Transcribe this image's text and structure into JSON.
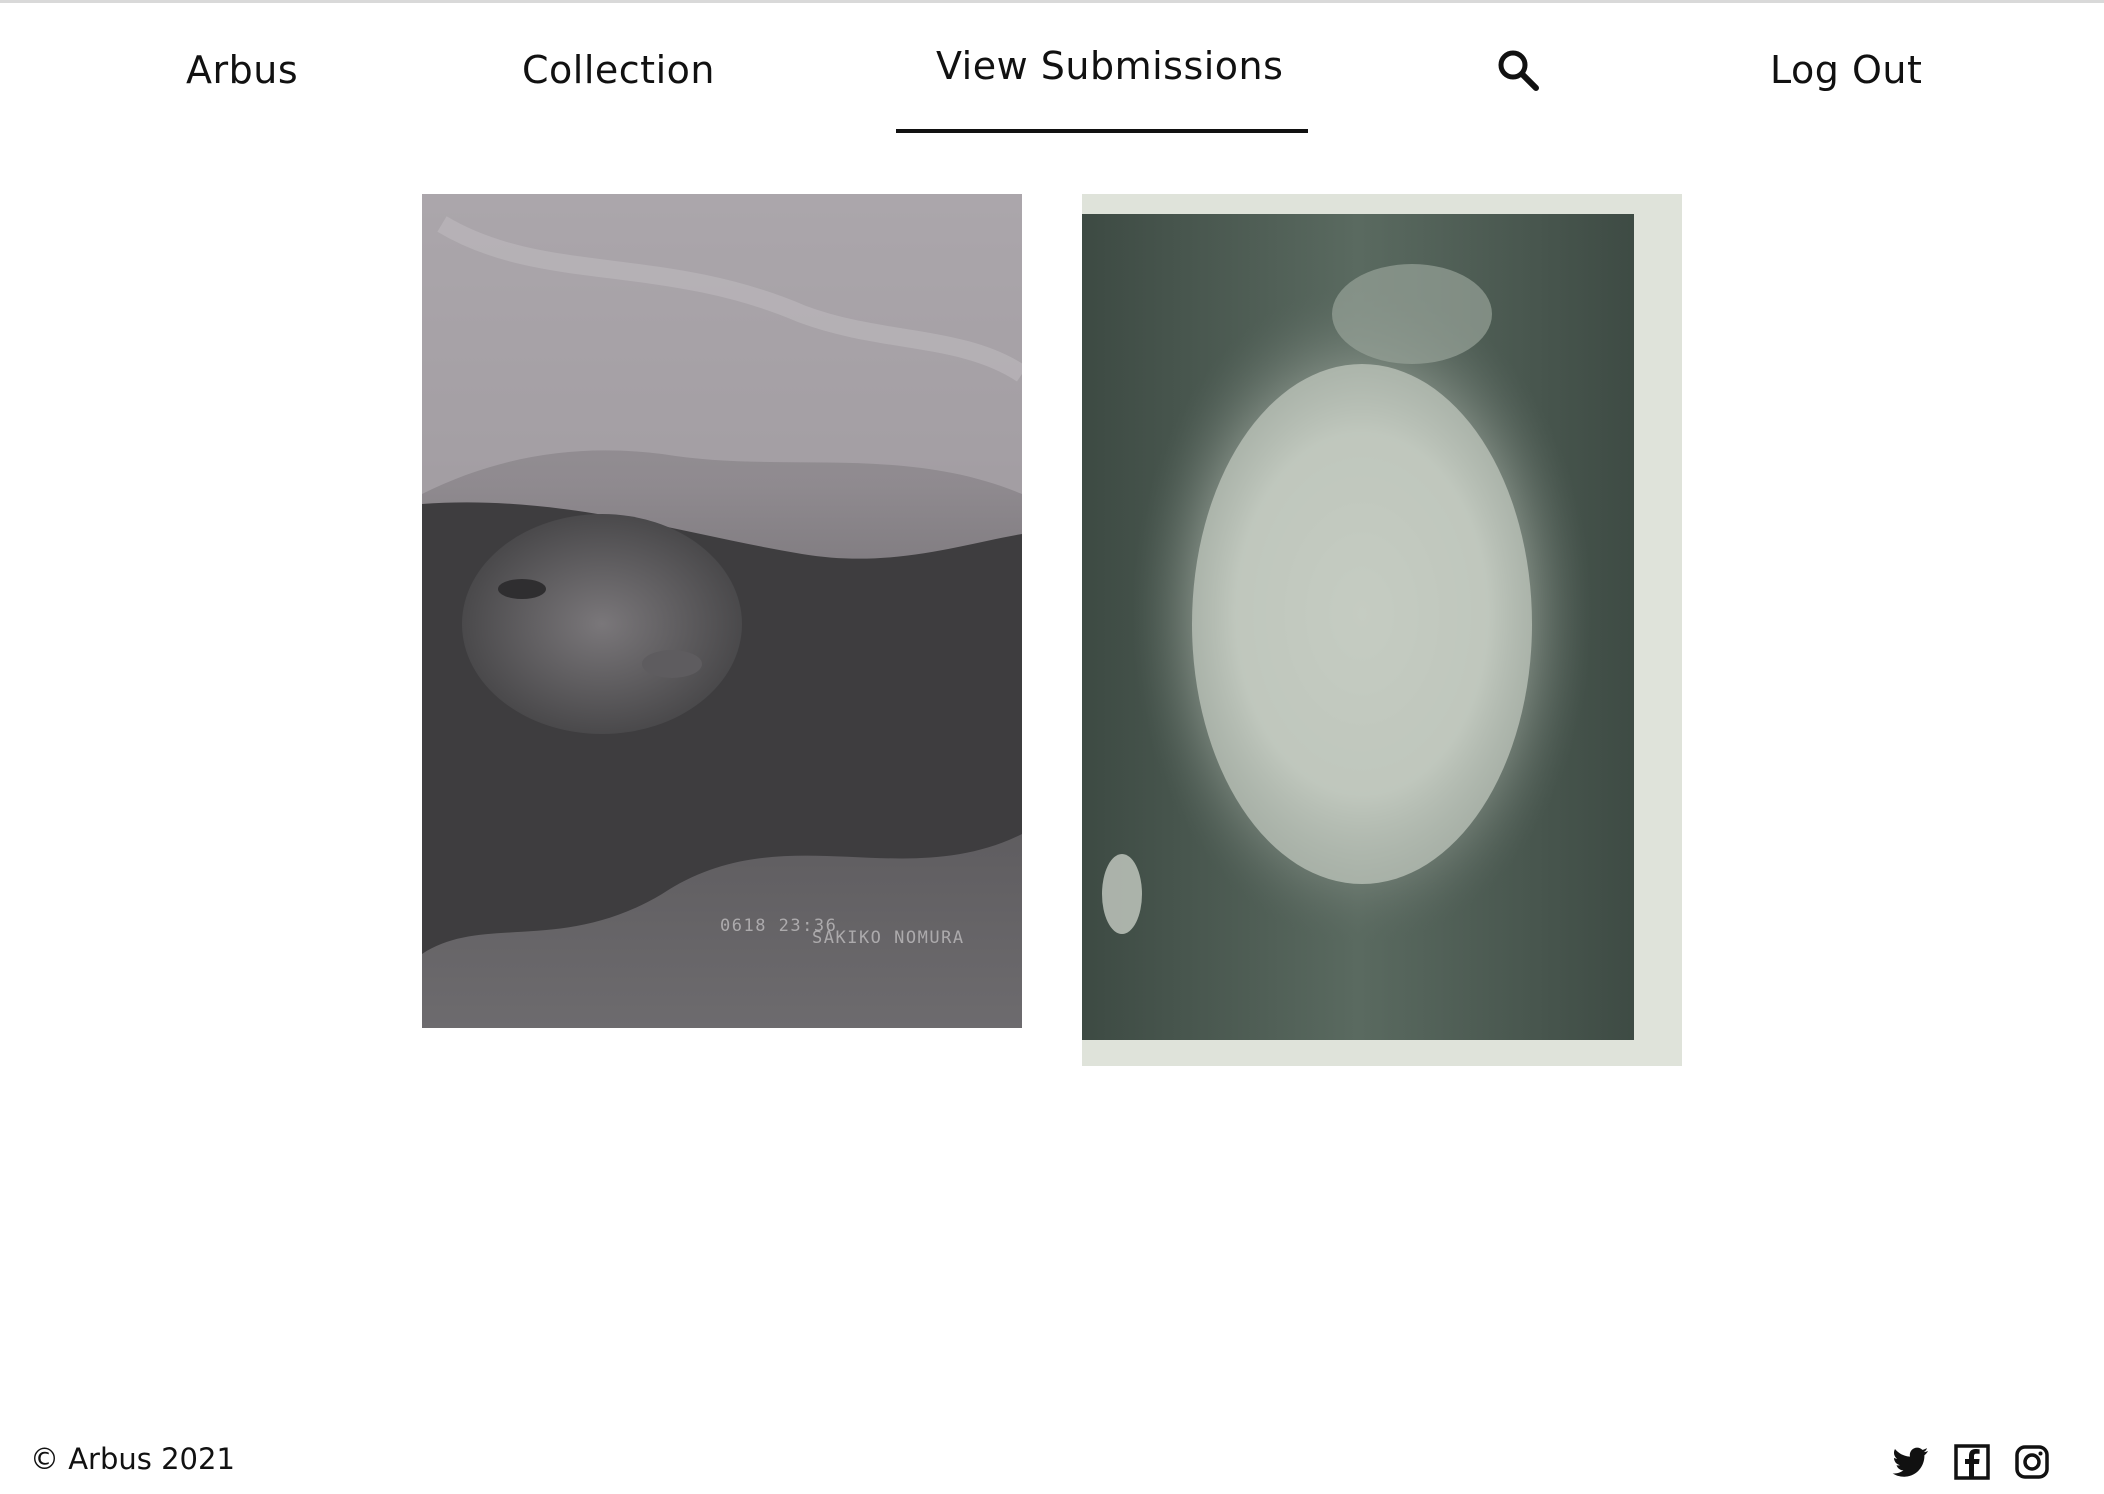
{
  "nav": {
    "brand": "Arbus",
    "collection": "Collection",
    "view_submissions": "View Submissions",
    "logout": "Log Out",
    "search_icon": "search-icon"
  },
  "submissions": [
    {
      "caption_date": "0618 23:36",
      "caption_name": "SAKIKO NOMURA",
      "tone": "grayscale portrait"
    },
    {
      "tone": "green-tinted cloud"
    }
  ],
  "footer": {
    "copyright": "© Arbus 2021",
    "icons": [
      "twitter-icon",
      "facebook-icon",
      "instagram-icon"
    ]
  },
  "colors": {
    "text": "#111111",
    "background": "#ffffff",
    "active_underline": "#111111"
  }
}
